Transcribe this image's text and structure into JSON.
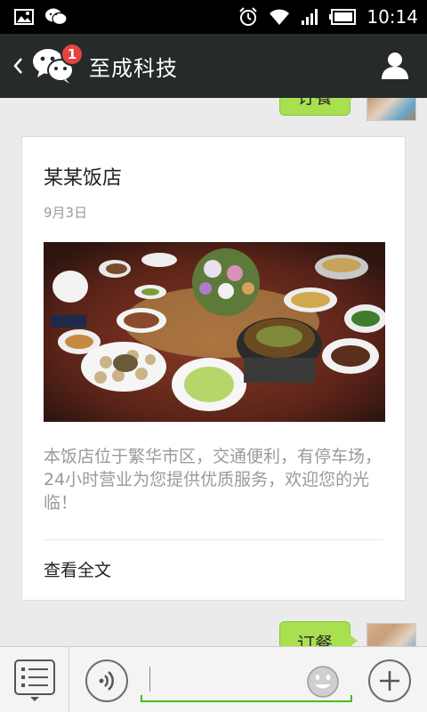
{
  "status_bar": {
    "time": "10:14",
    "left_icons": [
      "gallery-icon",
      "wechat-notification-icon"
    ],
    "right_icons": [
      "alarm-icon",
      "wifi-icon",
      "signal-icon",
      "battery-icon"
    ]
  },
  "header": {
    "unread_count": "1",
    "title": "至成科技"
  },
  "messages": {
    "top_bubble": "订餐",
    "bottom_bubble": "订餐"
  },
  "article": {
    "title": "某某饭店",
    "date": "9月3日",
    "description": "本饭店位于繁华市区，交通便利，有停车场，24小时营业为您提供优质服务，欢迎您的光临！",
    "read_more": "查看全文"
  },
  "colors": {
    "header_bg": "#262a2b",
    "bubble_green": "#a8e04f",
    "badge_red": "#e64340",
    "input_accent": "#45c01a"
  }
}
